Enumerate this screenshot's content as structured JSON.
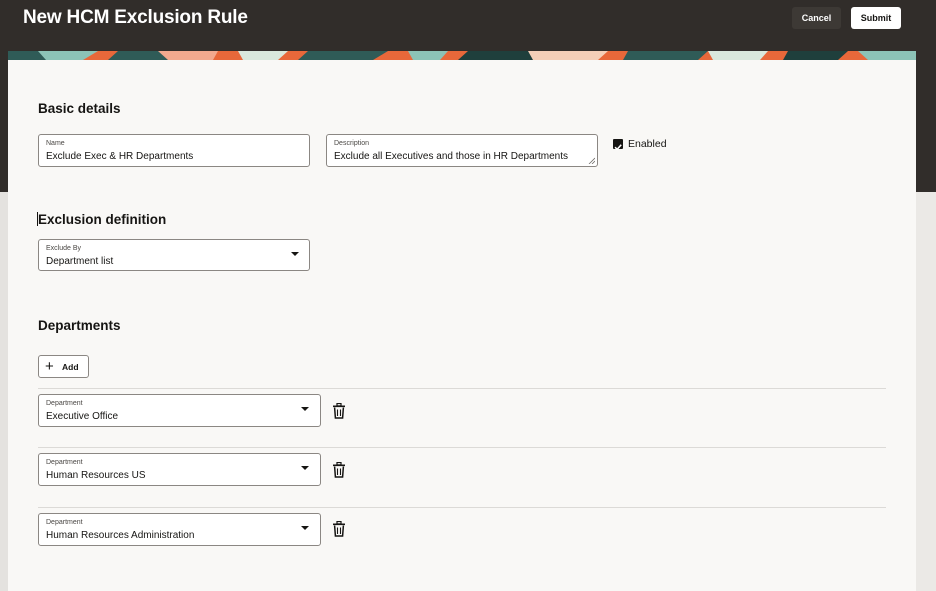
{
  "header": {
    "title": "New HCM Exclusion Rule",
    "cancel_label": "Cancel",
    "submit_label": "Submit"
  },
  "basic_details": {
    "title": "Basic details",
    "name": {
      "label": "Name",
      "value": "Exclude Exec & HR Departments"
    },
    "description": {
      "label": "Description",
      "value": "Exclude all Executives and those in HR Departments"
    },
    "enabled": {
      "label": "Enabled",
      "checked": true
    }
  },
  "exclusion_definition": {
    "title": "Exclusion definition",
    "exclude_by": {
      "label": "Exclude By",
      "value": "Department list"
    }
  },
  "departments": {
    "title": "Departments",
    "add_label": "Add",
    "items": [
      {
        "label": "Department",
        "value": "Executive Office"
      },
      {
        "label": "Department",
        "value": "Human Resources US"
      },
      {
        "label": "Department",
        "value": "Human Resources Administration"
      }
    ]
  },
  "icons": {
    "add": "plus-icon",
    "delete": "trash-icon",
    "dropdown": "chevron-down-icon",
    "checkbox": "checkmark-icon"
  },
  "colors": {
    "header_bg": "#312d2a",
    "card_bg": "#f9f8f6",
    "submit_bg": "#ffffff",
    "cancel_bg": "#3d3935"
  }
}
